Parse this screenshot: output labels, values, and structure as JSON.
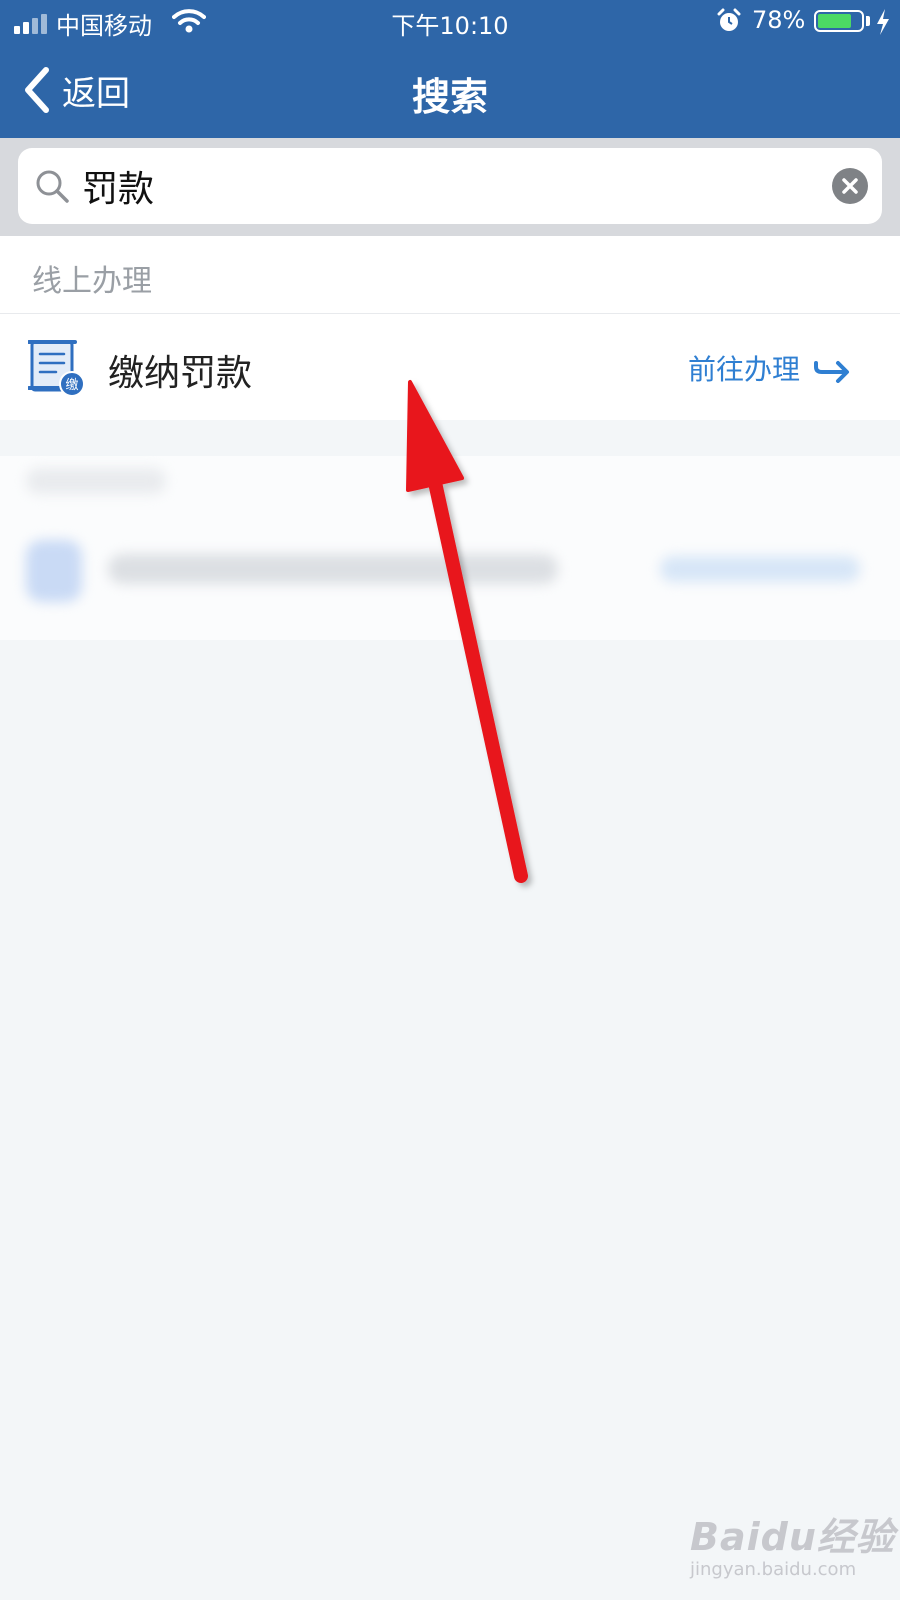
{
  "status_bar": {
    "carrier": "中国移动",
    "time": "下午10:10",
    "battery_percent": "78%",
    "battery_level": 0.78
  },
  "nav": {
    "back_label": "返回",
    "title": "搜索"
  },
  "search": {
    "query": "罚款"
  },
  "section": {
    "title": "线上办理"
  },
  "result": {
    "title": "缴纳罚款",
    "icon_badge": "缴",
    "action_label": "前往办理"
  },
  "watermark": {
    "brand": "Baidu经验",
    "url": "jingyan.baidu.com"
  },
  "colors": {
    "header_bg": "#2e66a8",
    "accent": "#2f7fd2",
    "annotation_arrow": "#e8141c",
    "battery_fill": "#4cd964"
  },
  "icons": [
    "signal-icon",
    "wifi-icon",
    "alarm-icon",
    "charging-bolt-icon",
    "back-chevron-icon",
    "search-icon",
    "clear-icon",
    "document-icon",
    "arrow-right-icon"
  ]
}
